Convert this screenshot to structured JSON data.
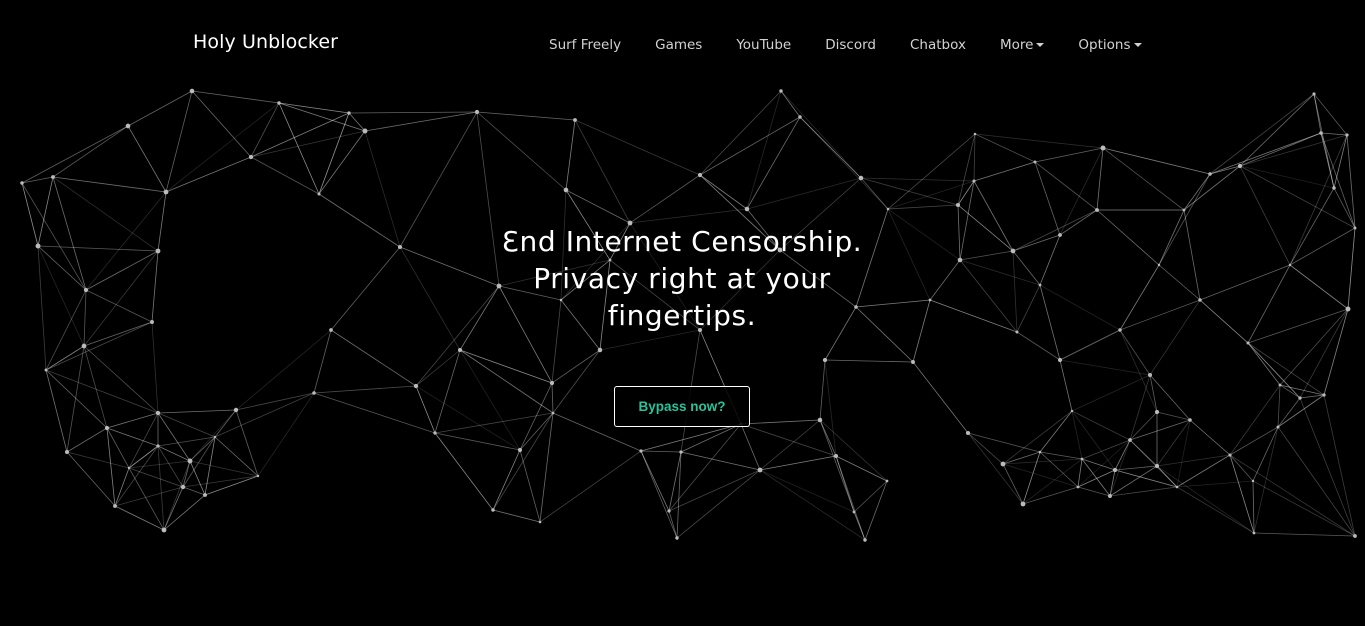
{
  "brand": {
    "title": "Holy Unblocker"
  },
  "nav": {
    "items": [
      {
        "label": "Surf Freely",
        "dropdown": false
      },
      {
        "label": "Games",
        "dropdown": false
      },
      {
        "label": "YouTube",
        "dropdown": false
      },
      {
        "label": "Discord",
        "dropdown": false
      },
      {
        "label": "Chatbox",
        "dropdown": false
      },
      {
        "label": "More",
        "dropdown": true
      },
      {
        "label": "Options",
        "dropdown": true
      }
    ]
  },
  "hero": {
    "title_line1": "Ɛnd Internet Censorship.",
    "title_line2": "Privacy right at your",
    "title_line3": "fingertips.",
    "cta_label": "Bypass now?"
  },
  "colors": {
    "background": "#000000",
    "text": "#ffffff",
    "nav_text": "#d2d2d2",
    "accent": "#25c49a",
    "network_line": "#ffffff"
  },
  "background": {
    "type": "particle-network",
    "icon": "network-particles"
  }
}
